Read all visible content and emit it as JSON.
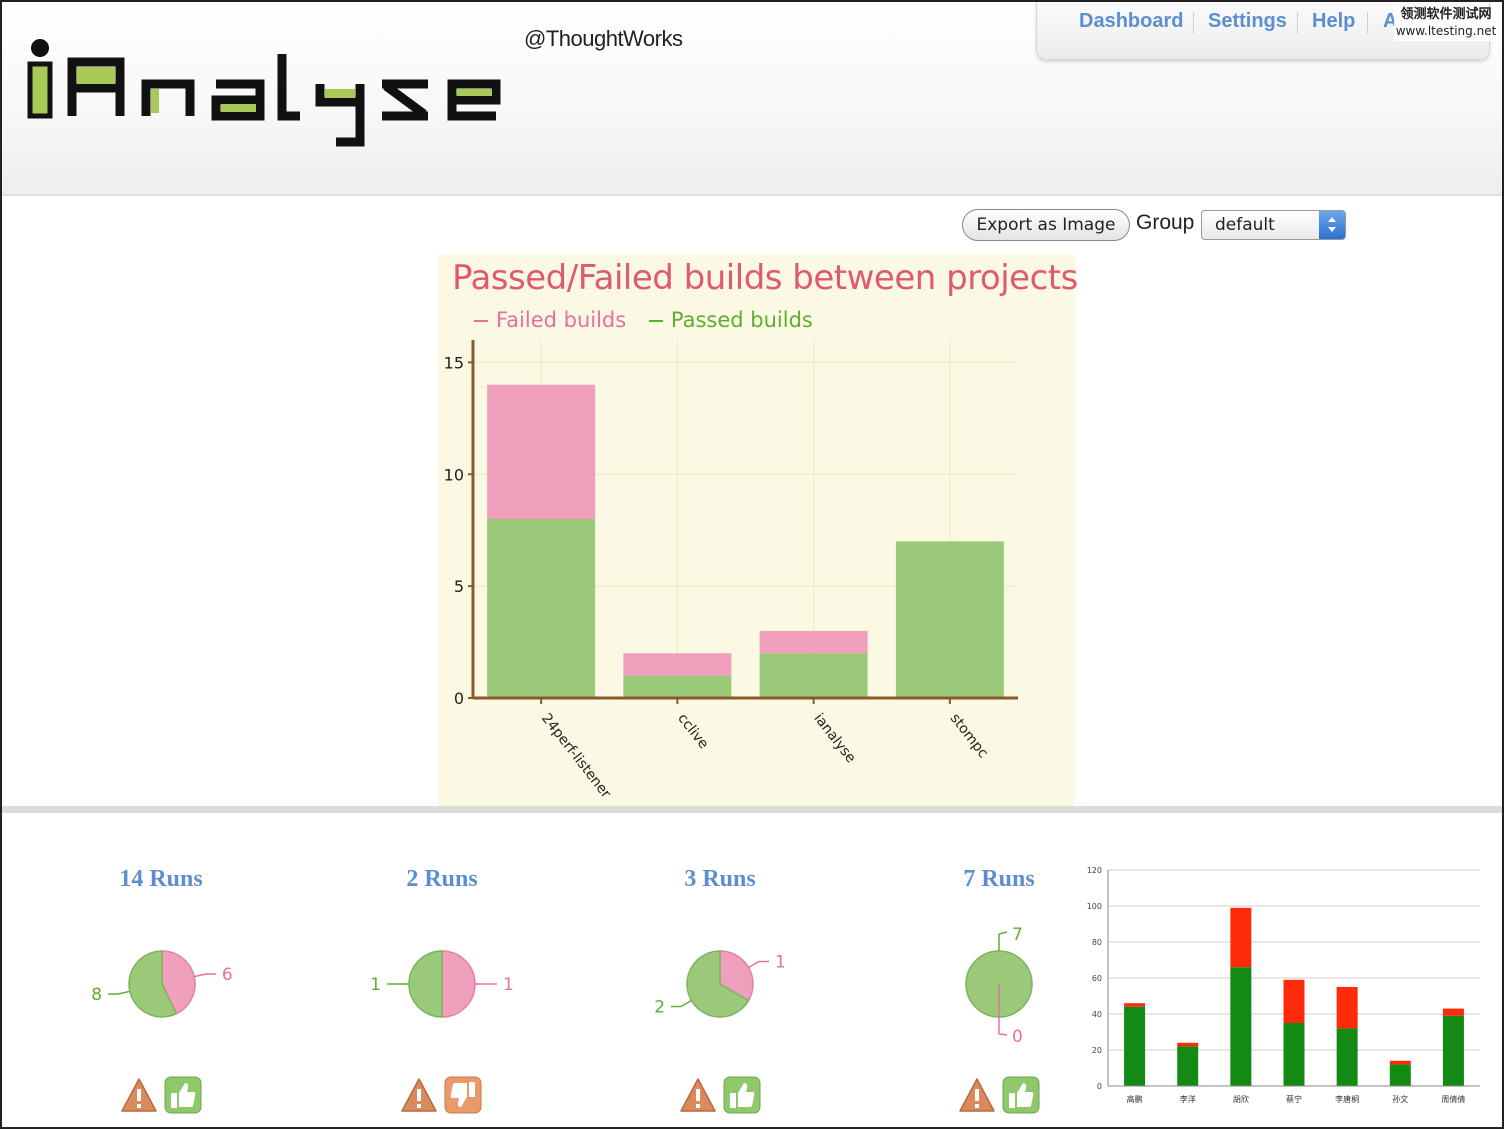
{
  "header": {
    "logo_text": "iAnalyse",
    "byline": "@ThoughtWorks",
    "nav": [
      {
        "label": "Dashboard"
      },
      {
        "label": "Settings"
      },
      {
        "label": "Help"
      },
      {
        "label": "A"
      }
    ],
    "watermark": {
      "line1": "领测软件测试网",
      "line2": "www.ltesting.net"
    }
  },
  "toolbar": {
    "export_label": "Export as Image",
    "group_label": "Group",
    "group_selected": "default"
  },
  "chart_data": [
    {
      "type": "bar",
      "stacked": true,
      "title": "Passed/Failed builds between projects",
      "categories": [
        "24perf-listener",
        "cclive",
        "ianalyse",
        "stompc"
      ],
      "series": [
        {
          "name": "Passed builds",
          "values": [
            8,
            1,
            2,
            7
          ],
          "color": "#9bc97a"
        },
        {
          "name": "Failed builds",
          "values": [
            6,
            1,
            1,
            0
          ],
          "color": "#f0a0bd"
        }
      ],
      "legend_order": [
        "Failed builds",
        "Passed builds"
      ],
      "yticks": [
        0,
        5,
        10,
        15
      ],
      "ylim": [
        0,
        16
      ],
      "grid": true,
      "legend_placement": "top-left"
    },
    {
      "type": "bar",
      "stacked": true,
      "categories": [
        "高鹏",
        "李洋",
        "胡欣",
        "蔡宁",
        "李唐桐",
        "孙文",
        "周倩倩"
      ],
      "series": [
        {
          "values": [
            44,
            22,
            66,
            35,
            32,
            12,
            39
          ],
          "color": "#138a13"
        },
        {
          "values": [
            2,
            2,
            33,
            24,
            23,
            2,
            4
          ],
          "color": "#ff2a0a"
        }
      ],
      "yticks": [
        0,
        20,
        40,
        60,
        80,
        100,
        120
      ],
      "ylim": [
        0,
        120
      ],
      "grid": true
    }
  ],
  "projects": [
    {
      "runs_label": "14 Runs",
      "passed": 8,
      "failed": 6,
      "status": "thumbs-up"
    },
    {
      "runs_label": "2 Runs",
      "passed": 1,
      "failed": 1,
      "status": "thumbs-down"
    },
    {
      "runs_label": "3 Runs",
      "passed": 2,
      "failed": 1,
      "status": "thumbs-up"
    },
    {
      "runs_label": "7 Runs",
      "passed": 7,
      "failed": 0,
      "status": "thumbs-up"
    }
  ],
  "colors": {
    "passed": "#9bc97a",
    "failed": "#f0a0bd",
    "passed_label": "#5fae2e",
    "failed_label": "#e8709a",
    "link": "#5b8fcf",
    "title": "#e05a6e",
    "logo_green": "#a7c957",
    "warning": "#d98a5e",
    "thumb": "#8fc76b",
    "thumb_down": "#e89a6a"
  }
}
